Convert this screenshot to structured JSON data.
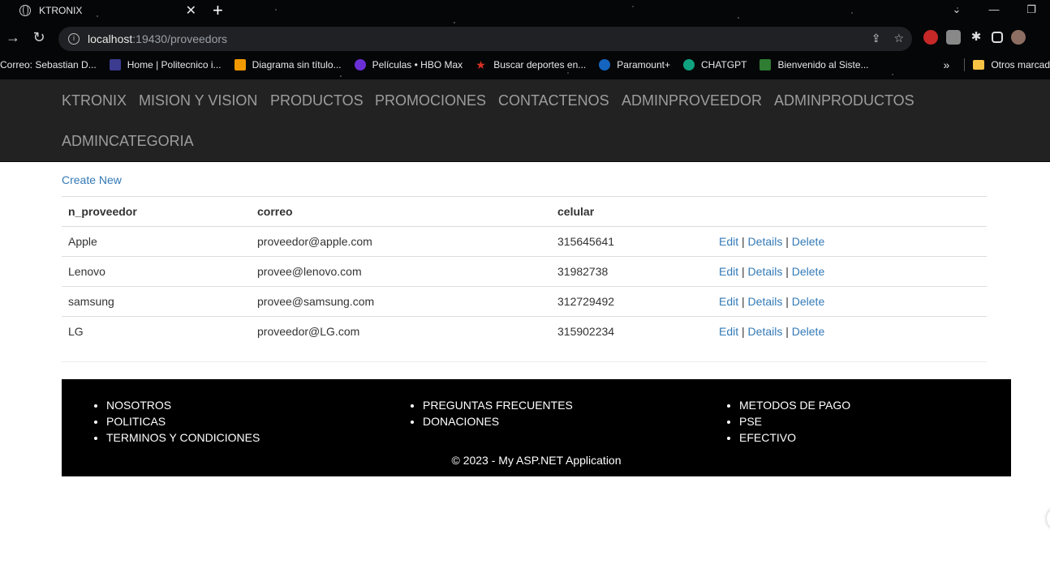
{
  "browser": {
    "tab_title": "KTRONIX",
    "tab_close": "✕",
    "new_tab": "+",
    "window_controls": [
      "⌄",
      "—",
      "❐"
    ],
    "url_host": "localhost",
    "url_path": ":19430/proveedors",
    "bookmarks": [
      {
        "label": "Correo: Sebastian D...",
        "color": "#1a73e8"
      },
      {
        "label": "Home | Politecnico i...",
        "color": "#3b3b8f"
      },
      {
        "label": "Diagrama sin título...",
        "color": "#f29900"
      },
      {
        "label": "Películas • HBO Max",
        "color": "#6b2fd6"
      },
      {
        "label": "Buscar deportes en...",
        "color": "#d93025"
      },
      {
        "label": "Paramount+",
        "color": "#1565c0"
      },
      {
        "label": "CHATGPT",
        "color": "#10a37f"
      },
      {
        "label": "Bienvenido al Siste...",
        "color": "#2e7d32"
      }
    ],
    "bookmarks_more": "»",
    "other_bookmarks": "Otros marcad"
  },
  "nav": {
    "items": [
      "KTRONIX",
      "MISION Y VISION",
      "PRODUCTOS",
      "PROMOCIONES",
      "CONTACTENOS",
      "ADMINPROVEEDOR",
      "ADMINPRODUCTOS",
      "ADMINCATEGORIA"
    ]
  },
  "main": {
    "create_new": "Create New",
    "headers": [
      "n_proveedor",
      "correo",
      "celular"
    ],
    "rows": [
      {
        "nombre": "Apple",
        "correo": "proveedor@apple.com",
        "celular": "315645641"
      },
      {
        "nombre": "Lenovo",
        "correo": "provee@lenovo.com",
        "celular": "31982738"
      },
      {
        "nombre": "samsung",
        "correo": "provee@samsung.com",
        "celular": "312729492"
      },
      {
        "nombre": "LG",
        "correo": "proveedor@LG.com",
        "celular": "315902234"
      }
    ],
    "actions": {
      "edit": "Edit",
      "details": "Details",
      "delete": "Delete",
      "sep": "|"
    }
  },
  "footer": {
    "col1": [
      "NOSOTROS",
      "POLITICAS",
      "TERMINOS Y CONDICIONES"
    ],
    "col2": [
      "PREGUNTAS FRECUENTES",
      "DONACIONES"
    ],
    "col3": [
      "METODOS DE PAGO",
      "PSE",
      "EFECTIVO"
    ],
    "copyright": "© 2023 - My ASP.NET Application"
  }
}
